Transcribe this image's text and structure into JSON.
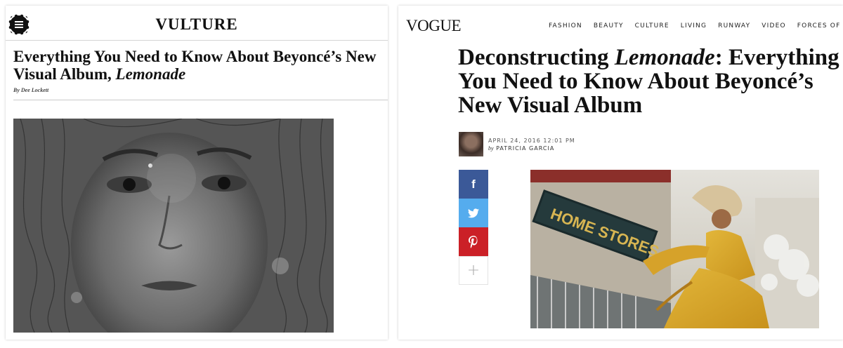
{
  "vulture": {
    "logo": "VULTURE",
    "article": {
      "title": "Everything You Need to Know About Beyoncé’s New Visual Album, ",
      "title_italic": "Lemonade",
      "byline": "By Dee Lockett"
    },
    "icons": {
      "menu": "hamburger-menu-icon"
    }
  },
  "vogue": {
    "logo": "VOGUE",
    "nav": [
      "FASHION",
      "BEAUTY",
      "CULTURE",
      "LIVING",
      "RUNWAY",
      "VIDEO",
      "FORCES OF FA"
    ],
    "article": {
      "title_prefix": "Deconstructing ",
      "title_italic": "Lemonade",
      "title_suffix": ": Everything You Need to Know About Beyoncé’s New Visual Album",
      "date": "APRIL 24, 2016 12:01 PM",
      "by": "by",
      "author": "PATRICIA GARCIA",
      "image_sign": "HOME STORES"
    },
    "share": {
      "facebook": "f",
      "plus": "+"
    },
    "colors": {
      "facebook": "#3b5998",
      "twitter": "#55acee",
      "pinterest": "#cb2027"
    }
  }
}
